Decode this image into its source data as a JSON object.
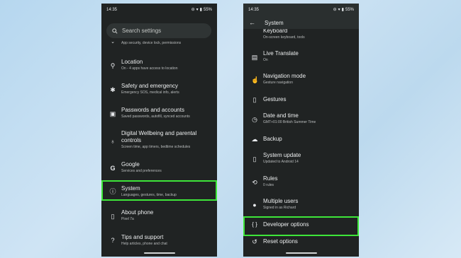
{
  "left_phone": {
    "status": {
      "time": "14:35",
      "battery": "55%"
    },
    "search_placeholder": "Search settings",
    "partial_subtitle": "App security, device lock, permissions",
    "items": [
      {
        "title": "Location",
        "sub": "On - 4 apps have access to location",
        "icon": "location-pin-icon"
      },
      {
        "title": "Safety and emergency",
        "sub": "Emergency SOS, medical info, alerts",
        "icon": "asterisk-icon"
      },
      {
        "title": "Passwords and accounts",
        "sub": "Saved passwords, autofill, synced accounts",
        "icon": "account-card-icon"
      },
      {
        "title": "Digital Wellbeing and parental",
        "title2": "controls",
        "sub": "Screen time, app timers, bedtime schedules",
        "icon": "wellbeing-icon"
      },
      {
        "title": "Google",
        "sub": "Services and preferences",
        "icon": "google-g-icon"
      },
      {
        "title": "System",
        "sub": "Languages, gestures, time, backup",
        "icon": "info-circle-icon"
      },
      {
        "title": "About phone",
        "sub": "Pixel 7a",
        "icon": "phone-icon"
      },
      {
        "title": "Tips and support",
        "sub": "Help articles, phone and chat",
        "icon": "help-circle-icon"
      }
    ]
  },
  "right_phone": {
    "status": {
      "time": "14:35",
      "battery": "55%"
    },
    "appbar_title": "System",
    "partial_item": {
      "title": "Keyboard",
      "sub": "On-screen keyboard, tools"
    },
    "items": [
      {
        "title": "Live Translate",
        "sub": "On",
        "icon": "translate-icon"
      },
      {
        "title": "Navigation mode",
        "sub": "Gesture navigation",
        "icon": "navigation-icon"
      },
      {
        "title": "Gestures",
        "sub": "",
        "icon": "gesture-icon"
      },
      {
        "title": "Date and time",
        "sub": "GMT+01:00 British Summer Time",
        "icon": "clock-icon"
      },
      {
        "title": "Backup",
        "sub": "",
        "icon": "cloud-backup-icon"
      },
      {
        "title": "System update",
        "sub": "Updated to Android 14",
        "icon": "system-update-icon"
      },
      {
        "title": "Rules",
        "sub": "0 rules",
        "icon": "rules-icon"
      },
      {
        "title": "Multiple users",
        "sub": "Signed in as Richard",
        "icon": "user-icon"
      },
      {
        "title": "Developer options",
        "sub": "",
        "icon": "braces-icon"
      },
      {
        "title": "Reset options",
        "sub": "",
        "icon": "reset-icon"
      }
    ]
  },
  "colors": {
    "highlight": "#3ee63a",
    "phone_bg": "#202323"
  }
}
